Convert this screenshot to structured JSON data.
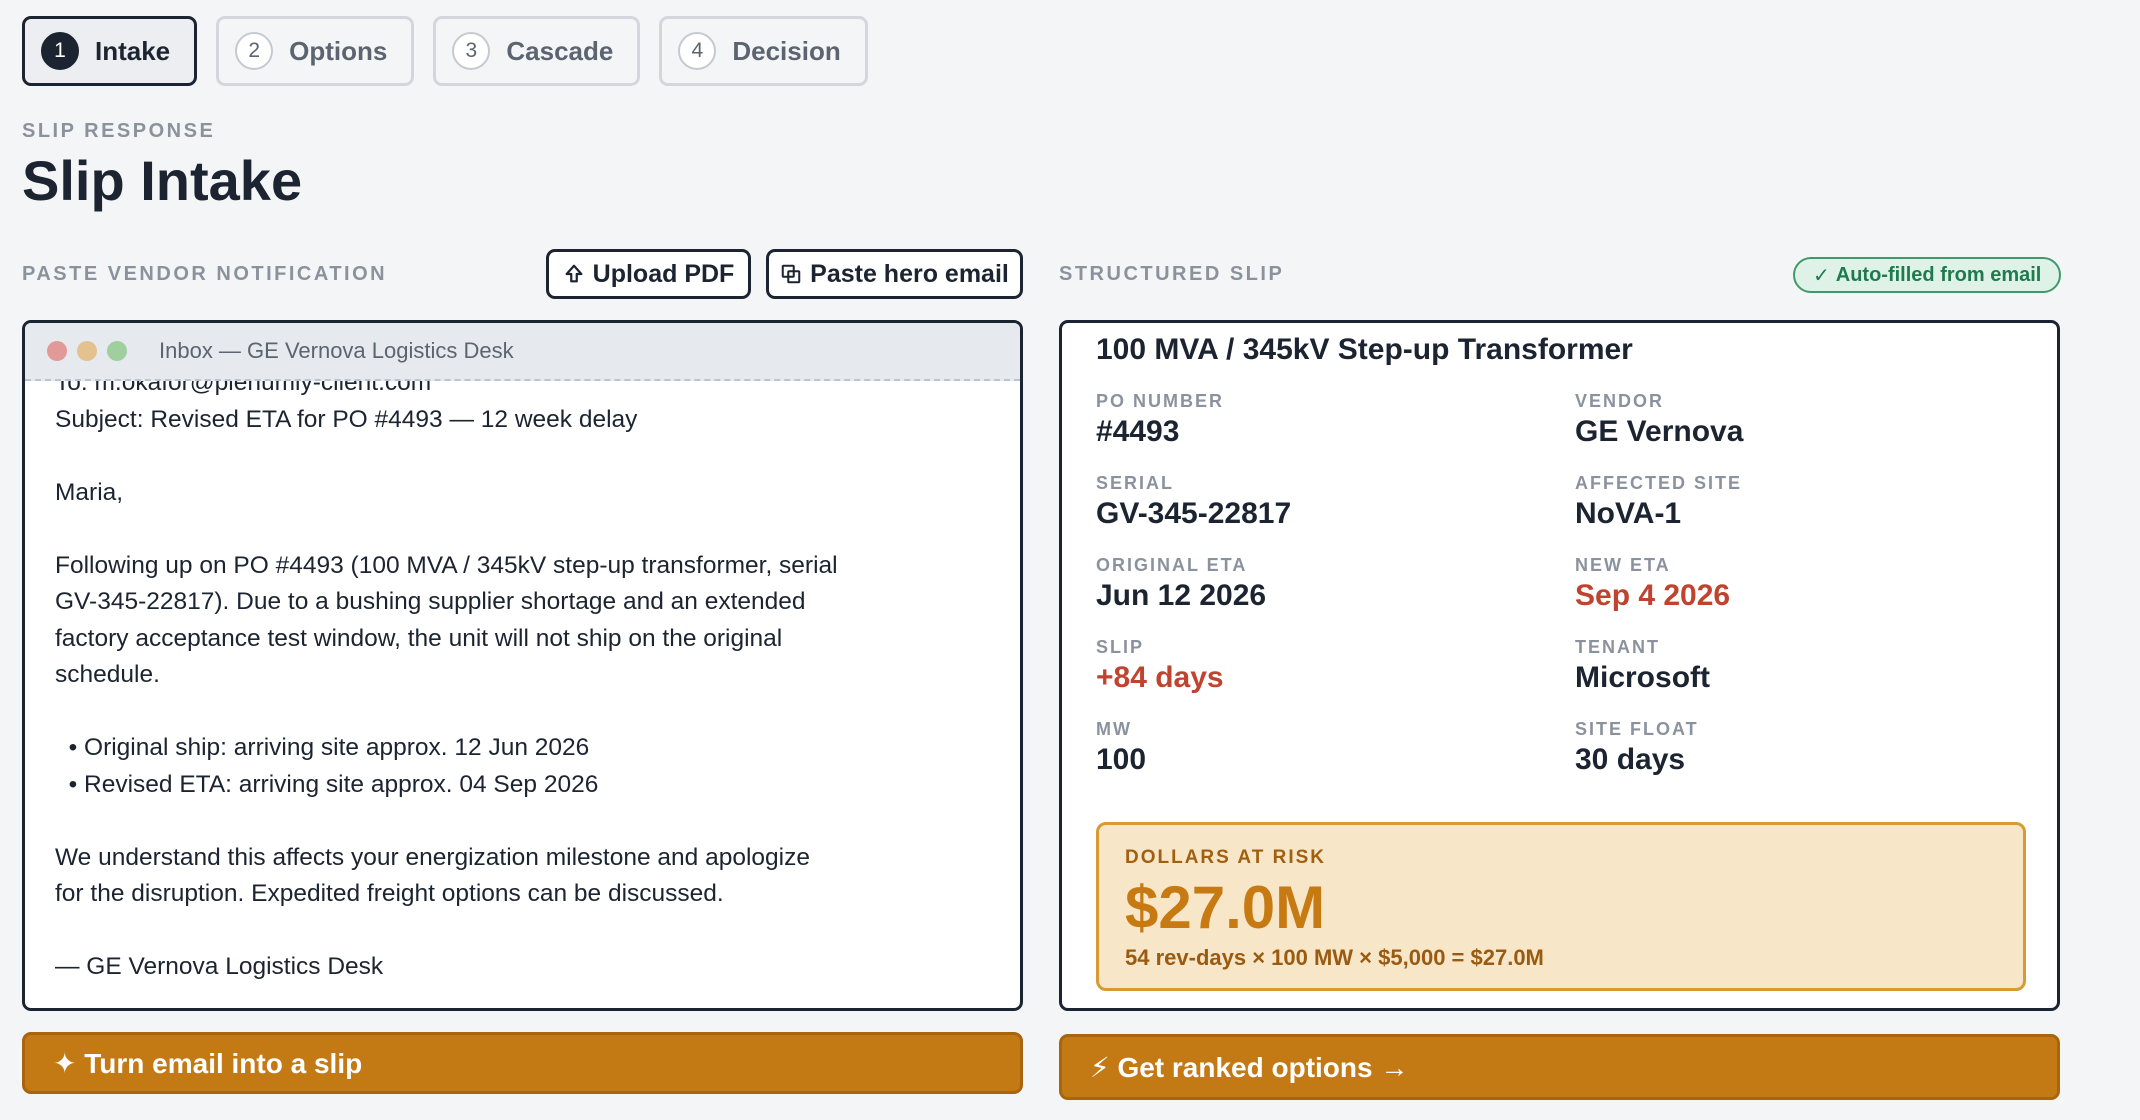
{
  "steps": [
    {
      "num": "1",
      "label": "Intake"
    },
    {
      "num": "2",
      "label": "Options"
    },
    {
      "num": "3",
      "label": "Cascade"
    },
    {
      "num": "4",
      "label": "Decision"
    }
  ],
  "header": {
    "eyebrow": "SLIP RESPONSE",
    "title": "Slip Intake"
  },
  "left": {
    "section_label": "PASTE VENDOR NOTIFICATION",
    "upload_label": "Upload PDF",
    "paste_label": "Paste hero email",
    "window_title": "Inbox — GE Vernova Logistics Desk",
    "email_text": "To: m.okafor@plenumly-client.com\nSubject: Revised ETA for PO #4493 — 12 week delay\n\nMaria,\n\nFollowing up on PO #4493 (100 MVA / 345kV step-up transformer, serial\nGV-345-22817). Due to a bushing supplier shortage and an extended\nfactory acceptance test window, the unit will not ship on the original\nschedule.\n\n  • Original ship: arriving site approx. 12 Jun 2026\n  • Revised ETA: arriving site approx. 04 Sep 2026\n\nWe understand this affects your energization milestone and apologize\nfor the disruption. Expedited freight options can be discussed.\n\n— GE Vernova Logistics Desk",
    "turn_button": "✦ Turn email into a slip"
  },
  "right": {
    "section_label": "STRUCTURED SLIP",
    "badge": "Auto-filled from email",
    "title": "100 MVA / 345kV Step-up Transformer",
    "fields": [
      {
        "key": "PO NUMBER",
        "value": "#4493"
      },
      {
        "key": "VENDOR",
        "value": "GE Vernova"
      },
      {
        "key": "SERIAL",
        "value": "GV-345-22817"
      },
      {
        "key": "AFFECTED SITE",
        "value": "NoVA-1"
      },
      {
        "key": "ORIGINAL ETA",
        "value": "Jun 12 2026"
      },
      {
        "key": "NEW ETA",
        "value": "Sep 4 2026"
      },
      {
        "key": "SLIP",
        "value": "+84 days"
      },
      {
        "key": "TENANT",
        "value": "Microsoft"
      },
      {
        "key": "MW",
        "value": "100"
      },
      {
        "key": "SITE FLOAT",
        "value": "30 days"
      }
    ],
    "risk": {
      "label": "DOLLARS AT RISK",
      "value": "$27.0M",
      "formula": "54 rev-days × 100 MW × $5,000 = $27.0M"
    },
    "options_button": "⚡ Get ranked options →"
  },
  "colors": {
    "accent": "#c47a14",
    "alert": "#c0432f",
    "success": "#1f7a4d",
    "ink": "#1b2430"
  }
}
